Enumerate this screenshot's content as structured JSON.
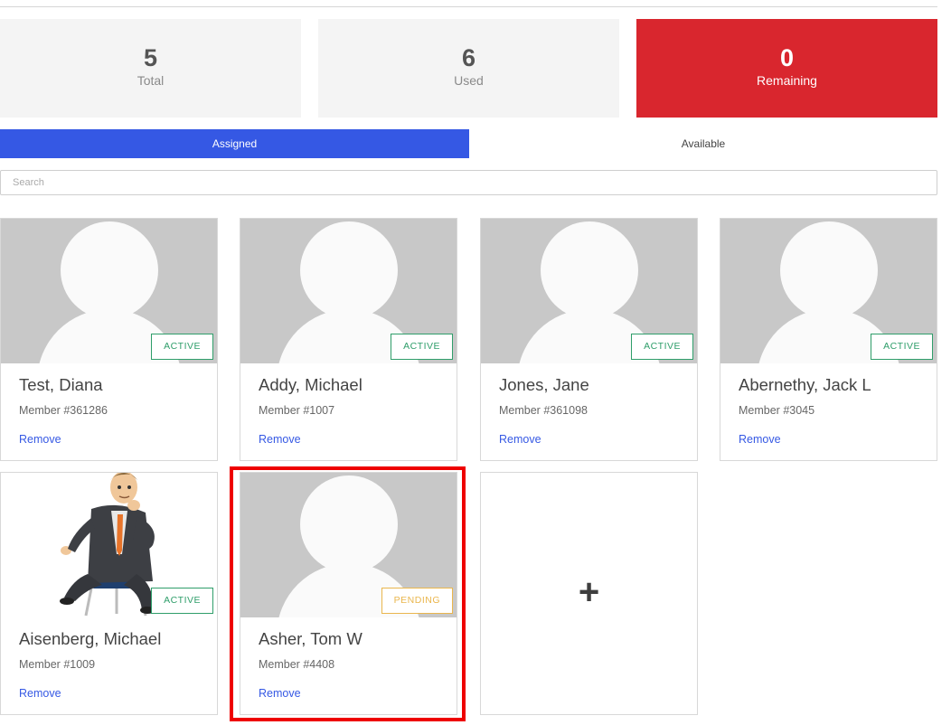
{
  "stats": {
    "total": {
      "value": "5",
      "label": "Total"
    },
    "used": {
      "value": "6",
      "label": "Used"
    },
    "remaining": {
      "value": "0",
      "label": "Remaining",
      "color": "#d9262e"
    }
  },
  "tabs": [
    {
      "label": "Assigned",
      "active": true
    },
    {
      "label": "Available",
      "active": false
    }
  ],
  "search": {
    "placeholder": "Search",
    "value": ""
  },
  "members": [
    {
      "name": "Test, Diana",
      "member": "Member #361286",
      "status": "ACTIVE",
      "remove": "Remove",
      "photo": "default-avatar"
    },
    {
      "name": "Addy, Michael",
      "member": "Member #1007",
      "status": "ACTIVE",
      "remove": "Remove",
      "photo": "default-avatar"
    },
    {
      "name": "Jones, Jane",
      "member": "Member #361098",
      "status": "ACTIVE",
      "remove": "Remove",
      "photo": "default-avatar"
    },
    {
      "name": "Abernethy, Jack L",
      "member": "Member #3045",
      "status": "ACTIVE",
      "remove": "Remove",
      "photo": "default-avatar"
    },
    {
      "name": "Aisenberg, Michael",
      "member": "Member #1009",
      "status": "ACTIVE",
      "remove": "Remove",
      "photo": "businessman-cartoon"
    },
    {
      "name": "Asher, Tom W",
      "member": "Member #4408",
      "status": "PENDING",
      "remove": "Remove",
      "photo": "default-avatar"
    }
  ],
  "add_card": {
    "icon": "plus-icon",
    "symbol": "+"
  },
  "colors": {
    "accent": "#3558e4",
    "active": "#2f9e6a",
    "pending": "#eab64d",
    "alert": "#d9262e"
  }
}
